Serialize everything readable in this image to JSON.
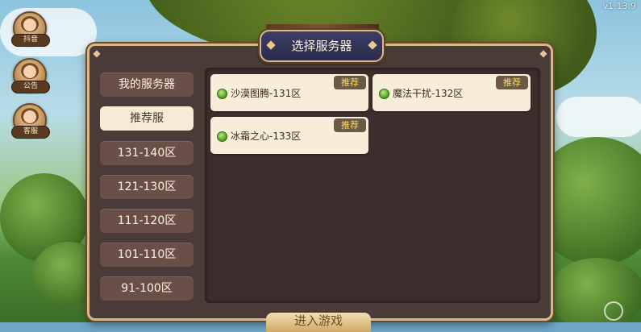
{
  "version": "v1.13.9",
  "side_buttons": [
    {
      "label": "抖音",
      "icon": "character-avatar-icon"
    },
    {
      "label": "公告",
      "icon": "announcement-avatar-icon"
    },
    {
      "label": "客服",
      "icon": "support-avatar-icon"
    }
  ],
  "dialog": {
    "title": "选择服务器",
    "tabs": [
      {
        "label": "我的服务器",
        "active": false
      },
      {
        "label": "推荐服",
        "active": true
      },
      {
        "label": "131-140区",
        "active": false
      },
      {
        "label": "121-130区",
        "active": false
      },
      {
        "label": "111-120区",
        "active": false
      },
      {
        "label": "101-110区",
        "active": false
      },
      {
        "label": "91-100区",
        "active": false
      }
    ],
    "servers": [
      {
        "name": "沙漠图腾-131区",
        "badge": "推荐",
        "status": "online"
      },
      {
        "name": "魔法干扰-132区",
        "badge": "推荐",
        "status": "online"
      },
      {
        "name": "冰霜之心-133区",
        "badge": "推荐",
        "status": "online"
      }
    ]
  },
  "enter_button": "进入游戏",
  "colors": {
    "panel": "#4a3a38",
    "content": "#3c2e2c",
    "tab": "#6a4f48",
    "tab_active": "#f6ecd6",
    "card": "#f7edd8",
    "badge_text": "#ffd86b",
    "status_online": "#4c9a1e",
    "border_gold": "#d9b98a"
  }
}
